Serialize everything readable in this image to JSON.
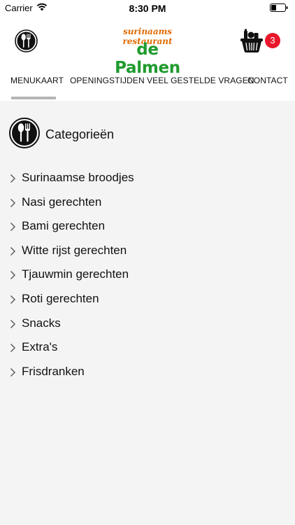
{
  "status_bar": {
    "carrier": "Carrier",
    "time": "8:30 PM"
  },
  "header": {
    "logo_tagline": "surinaams restaurant",
    "logo_name": "de Palmen",
    "cart_count": "3",
    "brand_green": "#1e9b2d",
    "brand_orange": "#e06a00",
    "badge_color": "#e8172b"
  },
  "tabs": [
    {
      "label": "MENUKAART",
      "active": true
    },
    {
      "label": "OPENINGSTIJDEN",
      "active": false
    },
    {
      "label": "VEEL GESTELDE VRAGEN",
      "active": false
    },
    {
      "label": "CONTACT",
      "active": false
    }
  ],
  "categories": {
    "title": "Categorieën",
    "items": [
      "Surinaamse broodjes",
      "Nasi gerechten",
      "Bami gerechten",
      "Witte rijst gerechten",
      "Tjauwmin gerechten",
      "Roti gerechten",
      "Snacks",
      "Extra's",
      "Frisdranken"
    ]
  }
}
